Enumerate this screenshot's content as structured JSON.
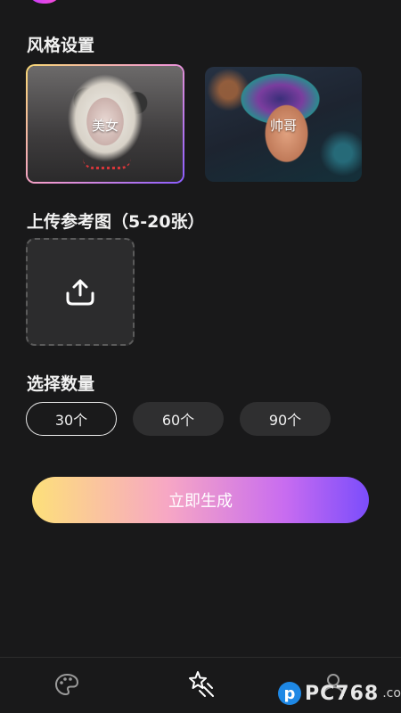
{
  "style_section": {
    "title": "风格设置",
    "cards": [
      {
        "label": "美女",
        "selected": true
      },
      {
        "label": "帅哥",
        "selected": false
      }
    ]
  },
  "upload_section": {
    "title": "上传参考图（5-20张）",
    "icon": "upload-icon"
  },
  "count_section": {
    "title": "选择数量",
    "options": [
      {
        "label": "30个",
        "selected": true
      },
      {
        "label": "60个",
        "selected": false
      },
      {
        "label": "90个",
        "selected": false
      }
    ]
  },
  "generate_button": {
    "label": "立即生成"
  },
  "tabbar": {
    "items": [
      {
        "icon": "palette-icon"
      },
      {
        "icon": "magic-stars-icon"
      },
      {
        "icon": "user-icon"
      }
    ]
  },
  "watermark": {
    "badge": "p",
    "text": "PC768",
    "sub": ".com"
  },
  "colors": {
    "background": "#19191a",
    "gradient_start": "#fde07a",
    "gradient_mid": "#f7a7c4",
    "gradient_end": "#7b4dfb",
    "selected_border": "#ececec"
  }
}
